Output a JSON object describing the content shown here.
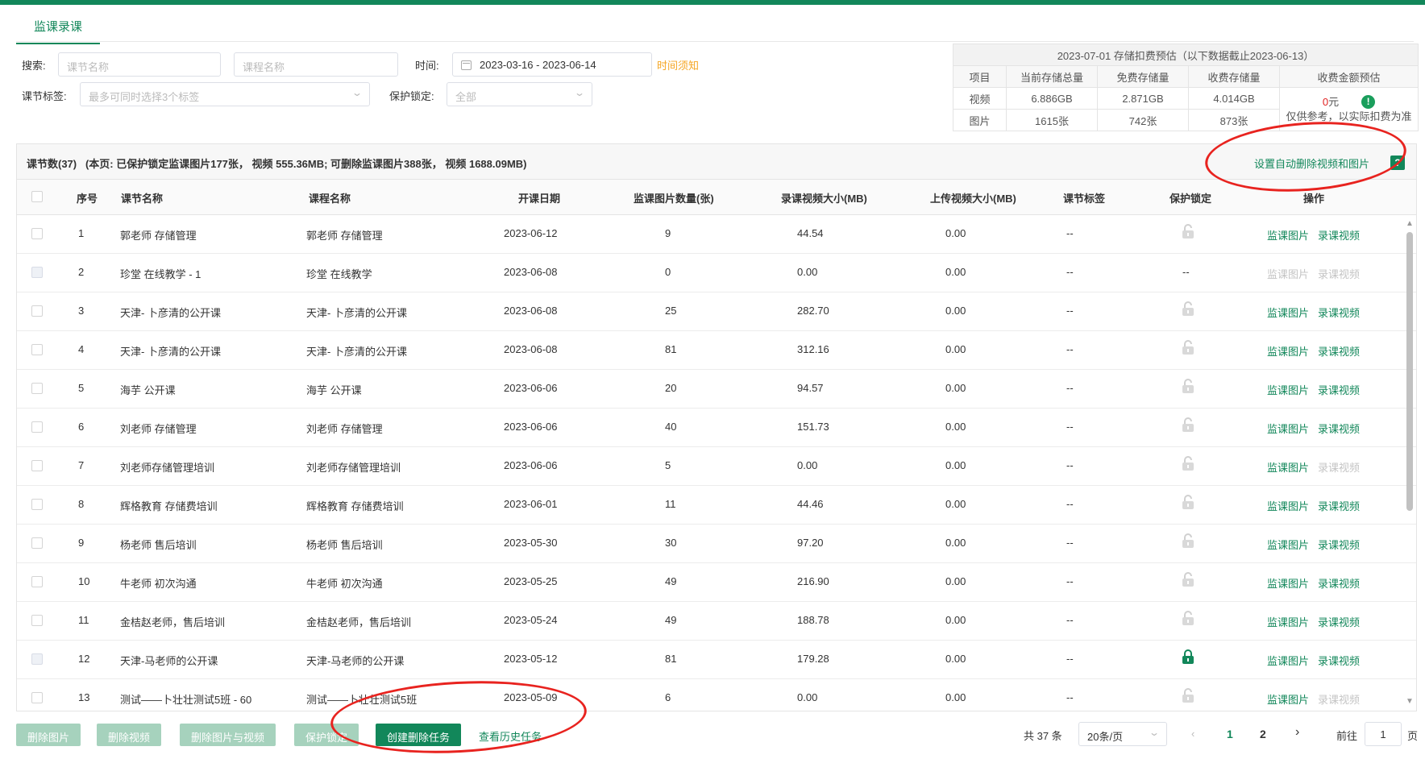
{
  "tab": "监课录课",
  "filters": {
    "search_label": "搜索:",
    "lesson_name_placeholder": "课节名称",
    "course_name_placeholder": "课程名称",
    "time_label": "时间:",
    "date_range": "2023-03-16  - 2023-06-14",
    "time_notice": "时间须知",
    "tag_label": "课节标签:",
    "tag_placeholder": "最多可同时选择3个标签",
    "lock_label": "保护锁定:",
    "lock_value": "全部"
  },
  "estimate": {
    "caption": "2023-07-01 存储扣费预估（以下数据截止2023-06-13）",
    "headers": [
      "项目",
      "当前存储总量",
      "免费存储量",
      "收费存储量",
      "收费金额预估"
    ],
    "video": [
      "视频",
      "6.886GB",
      "2.871GB",
      "4.014GB"
    ],
    "image": [
      "图片",
      "1615张",
      "742张",
      "873张"
    ],
    "fee_amount": "0",
    "fee_unit": "元",
    "fee_note": "仅供参考，以实际扣费为准"
  },
  "summary": {
    "text": "课节数(37)   (本页: 已保护锁定监课图片177张， 视频 555.36MB; 可删除监课图片388张， 视频 1688.09MB)",
    "auto_delete": "设置自动删除视频和图片",
    "help": "?"
  },
  "columns": [
    "序号",
    "课节名称",
    "课程名称",
    "开课日期",
    "监课图片数量(张)",
    "录课视频大小(MB)",
    "上传视频大小(MB)",
    "课节标签",
    "保护锁定",
    "操作"
  ],
  "action_labels": {
    "images": "监课图片",
    "videos": "录课视频"
  },
  "rows": [
    {
      "no": "1",
      "lesson": "郭老师 存储管理",
      "course": "郭老师 存储管理",
      "date": "2023-06-12",
      "images": "9",
      "rec": "44.54",
      "upl": "0.00",
      "tag": "--",
      "lock": "open",
      "img_on": true,
      "vid_on": true,
      "chk_dis": false
    },
    {
      "no": "2",
      "lesson": "珍堂 在线教学 - 1",
      "course": "珍堂 在线教学",
      "date": "2023-06-08",
      "images": "0",
      "rec": "0.00",
      "upl": "0.00",
      "tag": "--",
      "lock": "none",
      "img_on": false,
      "vid_on": false,
      "chk_dis": true
    },
    {
      "no": "3",
      "lesson": "天津- 卜彦清的公开课",
      "course": "天津- 卜彦清的公开课",
      "date": "2023-06-08",
      "images": "25",
      "rec": "282.70",
      "upl": "0.00",
      "tag": "--",
      "lock": "open",
      "img_on": true,
      "vid_on": true,
      "chk_dis": false
    },
    {
      "no": "4",
      "lesson": "天津- 卜彦清的公开课",
      "course": "天津- 卜彦清的公开课",
      "date": "2023-06-08",
      "images": "81",
      "rec": "312.16",
      "upl": "0.00",
      "tag": "--",
      "lock": "open",
      "img_on": true,
      "vid_on": true,
      "chk_dis": false
    },
    {
      "no": "5",
      "lesson": "海芋 公开课",
      "course": "海芋 公开课",
      "date": "2023-06-06",
      "images": "20",
      "rec": "94.57",
      "upl": "0.00",
      "tag": "--",
      "lock": "open",
      "img_on": true,
      "vid_on": true,
      "chk_dis": false
    },
    {
      "no": "6",
      "lesson": "刘老师 存储管理",
      "course": "刘老师 存储管理",
      "date": "2023-06-06",
      "images": "40",
      "rec": "151.73",
      "upl": "0.00",
      "tag": "--",
      "lock": "open",
      "img_on": true,
      "vid_on": true,
      "chk_dis": false
    },
    {
      "no": "7",
      "lesson": "刘老师存储管理培训",
      "course": "刘老师存储管理培训",
      "date": "2023-06-06",
      "images": "5",
      "rec": "0.00",
      "upl": "0.00",
      "tag": "--",
      "lock": "open",
      "img_on": true,
      "vid_on": false,
      "chk_dis": false
    },
    {
      "no": "8",
      "lesson": "辉格教育 存储费培训",
      "course": "辉格教育 存储费培训",
      "date": "2023-06-01",
      "images": "11",
      "rec": "44.46",
      "upl": "0.00",
      "tag": "--",
      "lock": "open",
      "img_on": true,
      "vid_on": true,
      "chk_dis": false
    },
    {
      "no": "9",
      "lesson": "杨老师 售后培训",
      "course": "杨老师 售后培训",
      "date": "2023-05-30",
      "images": "30",
      "rec": "97.20",
      "upl": "0.00",
      "tag": "--",
      "lock": "open",
      "img_on": true,
      "vid_on": true,
      "chk_dis": false
    },
    {
      "no": "10",
      "lesson": "牛老师 初次沟通",
      "course": "牛老师 初次沟通",
      "date": "2023-05-25",
      "images": "49",
      "rec": "216.90",
      "upl": "0.00",
      "tag": "--",
      "lock": "open",
      "img_on": true,
      "vid_on": true,
      "chk_dis": false
    },
    {
      "no": "11",
      "lesson": "金桔赵老师，售后培训",
      "course": "金桔赵老师，售后培训",
      "date": "2023-05-24",
      "images": "49",
      "rec": "188.78",
      "upl": "0.00",
      "tag": "--",
      "lock": "open",
      "img_on": true,
      "vid_on": true,
      "chk_dis": false
    },
    {
      "no": "12",
      "lesson": "天津-马老师的公开课",
      "course": "天津-马老师的公开课",
      "date": "2023-05-12",
      "images": "81",
      "rec": "179.28",
      "upl": "0.00",
      "tag": "--",
      "lock": "closed",
      "img_on": true,
      "vid_on": true,
      "chk_dis": true
    },
    {
      "no": "13",
      "lesson": "测试——卜壮壮测试5班 - 60",
      "course": "测试——卜壮壮测试5班",
      "date": "2023-05-09",
      "images": "6",
      "rec": "0.00",
      "upl": "0.00",
      "tag": "--",
      "lock": "open",
      "img_on": true,
      "vid_on": false,
      "chk_dis": false
    }
  ],
  "footer": {
    "delete_images": "删除图片",
    "delete_videos": "删除视频",
    "delete_both": "删除图片与视频",
    "protect_lock": "保护锁定",
    "create_task": "创建删除任务",
    "history": "查看历史任务",
    "total": "共 37 条",
    "page_size": "20条/页",
    "page1": "1",
    "page2": "2",
    "goto_label": "前往",
    "goto_value": "1",
    "page_unit": "页"
  },
  "colors": {
    "accent": "#12875a",
    "annotation": "#e8231f",
    "warning": "#f5a623"
  }
}
